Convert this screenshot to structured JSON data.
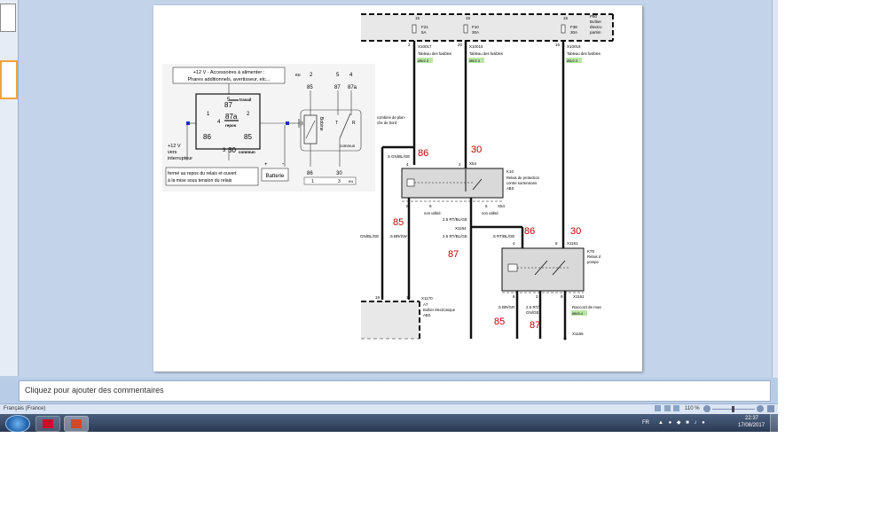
{
  "notes": {
    "placeholder": "Cliquez pour ajouter des commentaires"
  },
  "status": {
    "language": "Français (France)",
    "zoom": "110 %"
  },
  "taskbar": {
    "lang": "FR",
    "time": "22:37",
    "date": "17/08/2017"
  },
  "relay": {
    "title_line1": "+12 V - Accessoires à alimenter :",
    "title_line2": "Phares additionnels, avertisseur, etc...",
    "p5": "5",
    "travail": "travail",
    "p87": "87",
    "p1": "1",
    "p2": "2",
    "p4": "4",
    "p87a": "87a",
    "repos": "repos",
    "p86": "86",
    "p85": "85",
    "p3": "3",
    "p30": "30",
    "commun": "commun",
    "v12_1": "+12 V",
    "v12_2": "vers",
    "v12_3": "interrupteur",
    "note1": "fermé au repos du relais et ouvert",
    "note2": "à la mise sous tension du relais",
    "batterie": "Batterie",
    "plus": "+",
    "minus": "-"
  },
  "relay_sym": {
    "eu": "eu",
    "n2": "2",
    "n5": "5",
    "n4": "4",
    "s85": "85",
    "s87": "87",
    "s87a": "87a",
    "bobine": "Bobine",
    "t": "T",
    "r": "R",
    "commun": "commun",
    "s86": "86",
    "s30": "30",
    "b1": "1",
    "b3": "3",
    "eu2": "eu"
  },
  "schema": {
    "top_nums": [
      "15",
      "15",
      "15",
      "P50"
    ],
    "box_top_r": [
      "Boîtier",
      "électro",
      "partim"
    ],
    "f21": "F21",
    "a5": "5A",
    "f10": "F10",
    "a30": "30A",
    "f38": "F38",
    "a30b": "30A",
    "p2": "2",
    "p20": "20",
    "p16": "16",
    "x10017": "X10017",
    "x10015": "X10015",
    "x10016": "X10016",
    "tab": "Tableau des fusibles",
    "tab2": "Tableau des fusibles",
    "tab3": "Tableau des fusibles",
    "ref1": "Ø5/2.3",
    "ref2": "Ø5/2.3",
    "ref3": "Ø5/2.3",
    "combi1": "combiné de plan-",
    "combi2": "che de bord",
    "l86": "86",
    "l30": "30",
    "gnbl": ".5 GN/BL/GE",
    "k4": "4",
    "k2": "2",
    "x54": "X54",
    "k10": "K10",
    "k10a": "Relais de protection",
    "k10b": "contre surtensions",
    "k10c": "ABS",
    "k6": "6",
    "k9": "9",
    "k5": "5",
    "nonu1": "non utilisé",
    "x54b": "X54",
    "nonu2": "non utilisé",
    "l85": "85",
    "rt1": "2.5 RT/BL/GE",
    "x1164": "X1164",
    "rt2": "2.5 RT/BL/GE",
    "l86b": "86",
    "l30b": "30",
    ".5rt": ".5 RT/BL/GE",
    "k4b": "4",
    "k8": "8",
    "x1161": "X1161",
    "gnblge": "GN/BL/GE",
    ".5br": ".5 BR/SW",
    "l87": "87",
    "k75": "K75",
    "k75a": "Relais d",
    "k75b": "pompe",
    "n19": "19",
    "n1": "1",
    "x1170": "X1170",
    "a7": "A7",
    "a7a": "Boîtier électronique",
    "a7b": "ABS",
    "k6b": "6",
    "k2b": "2",
    "k9b": "9",
    "x1161b": "X1161",
    ".5brgr": ".5 BR/GR",
    "25rt": "2.5 RT/",
    "gnge": "GN/GE",
    "racc": "Raccord de mas",
    "x2": "Ø6/5.4",
    "l85b": "85",
    "l87b": "87",
    "x1165": "X1165"
  }
}
